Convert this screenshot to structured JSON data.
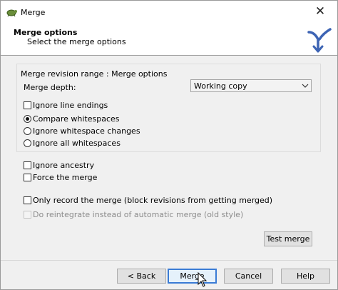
{
  "window": {
    "title": "Merge"
  },
  "header": {
    "title": "Merge options",
    "subtitle": "Select the merge options"
  },
  "group": {
    "legend": "Merge revision range : Merge options",
    "depth_label": "Merge depth:",
    "depth_value": "Working copy",
    "ignore_line_endings": "Ignore line endings",
    "whitespace": {
      "compare": "Compare whitespaces",
      "ignore_changes": "Ignore whitespace changes",
      "ignore_all": "Ignore all whitespaces",
      "selected": "compare"
    }
  },
  "options": {
    "ignore_ancestry": "Ignore ancestry",
    "force_merge": "Force the merge",
    "only_record": "Only record the merge (block revisions from getting merged)",
    "reintegrate": "Do reintegrate instead of automatic merge (old style)"
  },
  "buttons": {
    "test_merge": "Test merge",
    "back": "< Back",
    "merge": "Merge",
    "cancel": "Cancel",
    "help": "Help"
  },
  "colors": {
    "accent": "#3a7bd5",
    "logo": "#3d64b4"
  }
}
